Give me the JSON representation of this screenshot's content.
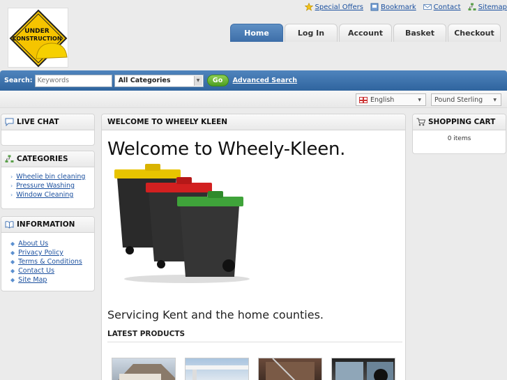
{
  "logo": {
    "line1": "UNDER",
    "line2": "CONSTRUCTION"
  },
  "toplinks": [
    {
      "label": "Special Offers",
      "icon": "star-icon"
    },
    {
      "label": "Bookmark",
      "icon": "bookmark-icon"
    },
    {
      "label": "Contact",
      "icon": "envelope-icon"
    },
    {
      "label": "Sitemap",
      "icon": "sitemap-icon"
    }
  ],
  "tabs": [
    "Home",
    "Log In",
    "Account",
    "Basket",
    "Checkout"
  ],
  "search": {
    "label": "Search:",
    "placeholder": "Keywords",
    "category": "All Categories",
    "go": "Go",
    "advanced": "Advanced Search"
  },
  "language": "English",
  "currency": "Pound Sterling",
  "live_chat": {
    "title": "LIVE CHAT"
  },
  "categories": {
    "title": "CATEGORIES",
    "items": [
      "Wheelie bin cleaning",
      "Pressure Washing",
      "Window Cleaning"
    ]
  },
  "information": {
    "title": "INFORMATION",
    "items": [
      "About Us",
      "Privacy Policy",
      "Terms & Conditions",
      "Contact Us",
      "Site Map"
    ]
  },
  "main": {
    "header": "WELCOME TO WHEELY KLEEN",
    "title": "Welcome to Wheely-Kleen.",
    "servicing": "Servicing Kent and the home counties.",
    "latest": "LATEST PRODUCTS"
  },
  "cart": {
    "title": "SHOPPING CART",
    "count": "0 items"
  },
  "colors": {
    "accent": "#3d6ea8",
    "link": "#1a4f9e",
    "go": "#4e9e22"
  }
}
